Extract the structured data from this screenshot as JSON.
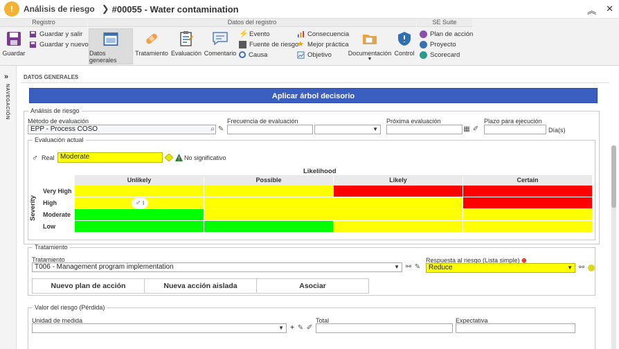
{
  "titlebar": {
    "app_title": "Análisis de riesgo",
    "record_title": "#00055 - Water contamination",
    "logo_icon": "warning-icon"
  },
  "ribbon": {
    "groups": {
      "registro": "Registro",
      "datos": "Datos del registro",
      "suite": "SE Suite"
    },
    "guardar": "Guardar",
    "guardar_salir": "Guardar y salir",
    "guardar_nuevo": "Guardar y nuevo",
    "datos_generales": "Datos generales",
    "tratamiento": "Tratamiento",
    "evaluacion": "Evaluación",
    "comentario": "Comentario",
    "evento": "Evento",
    "fuente_riesgo": "Fuente de riesgo",
    "causa": "Causa",
    "consecuencia": "Consecuencia",
    "mejor_practica": "Mejor práctica",
    "objetivo": "Objetivo",
    "documentacion": "Documentación",
    "control": "Control",
    "plan_accion": "Plan de acción",
    "proyecto": "Proyecto",
    "scorecard": "Scorecard"
  },
  "nav": {
    "label": "NAVEGACIÓN"
  },
  "section": {
    "title": "DATOS GENERALES",
    "apply_button": "Aplicar árbol decisorio"
  },
  "analisis": {
    "legend": "Análisis de riesgo",
    "metodo_label": "Método de evaluación",
    "metodo_value": "EPP - Process COSO",
    "frecuencia_label": "Frecuencia de evaluación",
    "frecuencia_value": "",
    "proxima_label": "Próxima evaluación",
    "proxima_value": "",
    "plazo_label": "Plazo para ejecución",
    "plazo_value": "",
    "plazo_unit": "Día(s)"
  },
  "evaluacion": {
    "legend": "Evaluación actual",
    "real_label": "Real",
    "real_value": "Moderate",
    "significance": "No significativo",
    "likelihood_label": "Likelihood",
    "severity_label": "Severity",
    "columns": [
      "Unlikely",
      "Possible",
      "Likely",
      "Certain"
    ],
    "rows": [
      "Very High",
      "High",
      "Moderate",
      "Low"
    ],
    "marker_label": "I",
    "colors": {
      "yellow": "#ffff00",
      "red": "#ff0000",
      "green": "#00ff00"
    }
  },
  "tratamiento": {
    "legend": "Tratamiento",
    "tratamiento_label": "Tratamiento",
    "tratamiento_value": "T006 - Management program implementation",
    "respuesta_label": "Respuesta al riesgo (Lista simple)",
    "respuesta_value": "Reduce",
    "btn_nuevo_plan": "Nuevo plan de acción",
    "btn_nueva_accion": "Nueva acción aislada",
    "btn_asociar": "Asociar"
  },
  "valor": {
    "legend": "Valor del riesgo (Pérdida)",
    "unidad_label": "Unidad de medida",
    "unidad_value": "",
    "total_label": "Total",
    "total_value": "",
    "expectativa_label": "Expectativa",
    "expectativa_value": ""
  }
}
